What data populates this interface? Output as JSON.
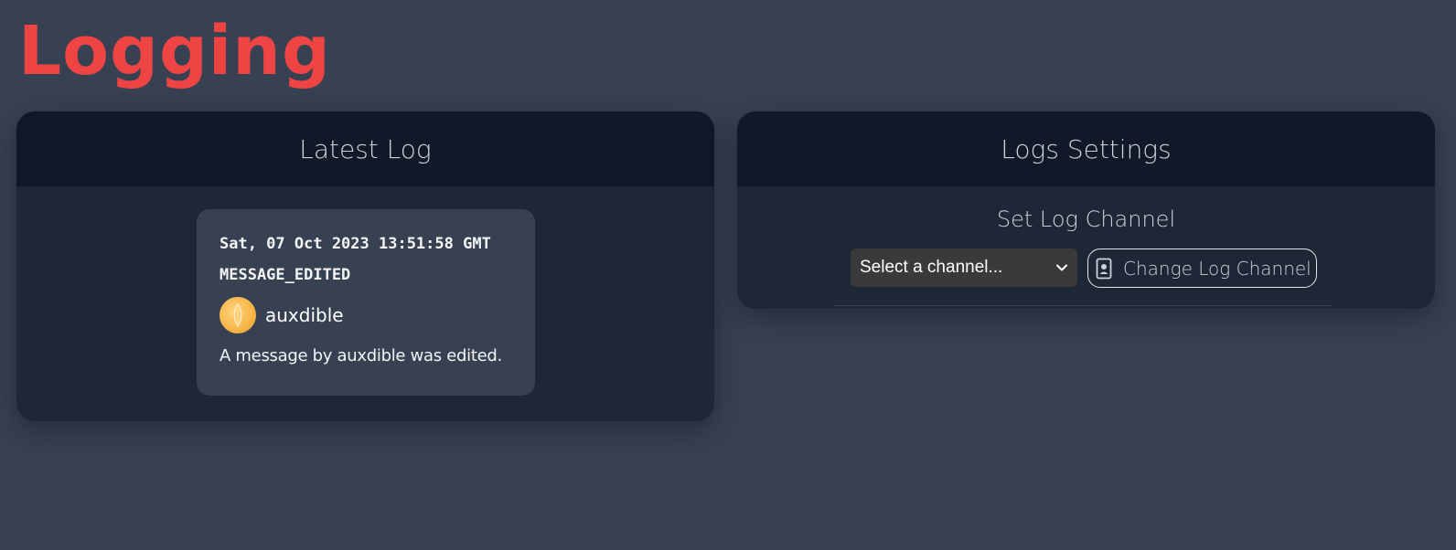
{
  "page": {
    "title": "Logging"
  },
  "latest_log": {
    "header": "Latest Log",
    "entry": {
      "timestamp": "Sat, 07 Oct 2023 13:51:58 GMT",
      "type": "MESSAGE_EDITED",
      "username": "auxdible",
      "message": "A message by auxdible was edited.",
      "avatar_icon": "user-avatar"
    }
  },
  "settings": {
    "header": "Logs Settings",
    "section_title": "Set Log Channel",
    "channel_select": {
      "selected": "Select a channel..."
    },
    "change_button": {
      "label": "Change Log Channel",
      "icon": "id-badge-icon"
    }
  },
  "colors": {
    "accent": "#ef4444",
    "background": "#384152",
    "card": "#1f2737",
    "card_header": "#111827"
  }
}
